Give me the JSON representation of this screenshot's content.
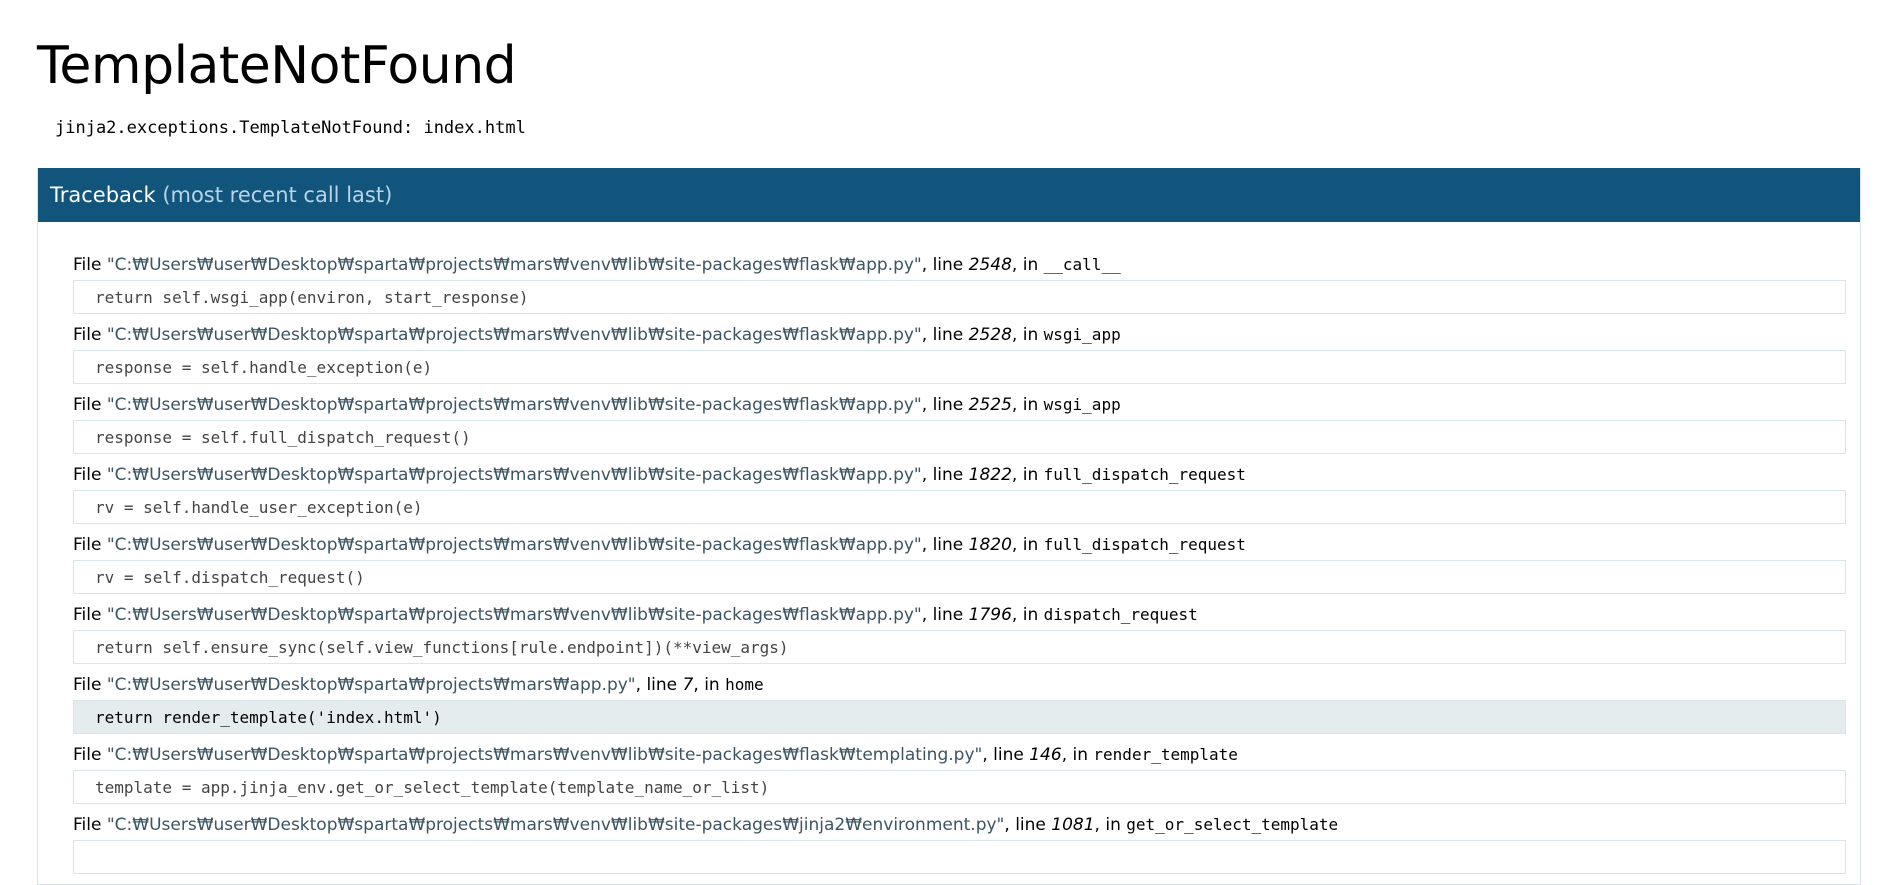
{
  "error": {
    "title": "TemplateNotFound",
    "message": "jinja2.exceptions.TemplateNotFound: index.html"
  },
  "traceback": {
    "header": "Traceback",
    "header_note": "(most recent call last)",
    "file_word": "File",
    "line_word": "line",
    "in_word": "in",
    "frames": [
      {
        "filename": "\"C:₩Users₩user₩Desktop₩sparta₩projects₩mars₩venv₩lib₩site-packages₩flask₩app.py\"",
        "lineno": "2548",
        "function": "__call__",
        "code": "return self.wsgi_app(environ, start_response)"
      },
      {
        "filename": "\"C:₩Users₩user₩Desktop₩sparta₩projects₩mars₩venv₩lib₩site-packages₩flask₩app.py\"",
        "lineno": "2528",
        "function": "wsgi_app",
        "code": "response = self.handle_exception(e)"
      },
      {
        "filename": "\"C:₩Users₩user₩Desktop₩sparta₩projects₩mars₩venv₩lib₩site-packages₩flask₩app.py\"",
        "lineno": "2525",
        "function": "wsgi_app",
        "code": "response = self.full_dispatch_request()"
      },
      {
        "filename": "\"C:₩Users₩user₩Desktop₩sparta₩projects₩mars₩venv₩lib₩site-packages₩flask₩app.py\"",
        "lineno": "1822",
        "function": "full_dispatch_request",
        "code": "rv = self.handle_user_exception(e)"
      },
      {
        "filename": "\"C:₩Users₩user₩Desktop₩sparta₩projects₩mars₩venv₩lib₩site-packages₩flask₩app.py\"",
        "lineno": "1820",
        "function": "full_dispatch_request",
        "code": "rv = self.dispatch_request()"
      },
      {
        "filename": "\"C:₩Users₩user₩Desktop₩sparta₩projects₩mars₩venv₩lib₩site-packages₩flask₩app.py\"",
        "lineno": "1796",
        "function": "dispatch_request",
        "code": "return self.ensure_sync(self.view_functions[rule.endpoint])(**view_args)"
      },
      {
        "filename": "\"C:₩Users₩user₩Desktop₩sparta₩projects₩mars₩app.py\"",
        "lineno": "7",
        "function": "home",
        "code": "return render_template('index.html')"
      },
      {
        "filename": "\"C:₩Users₩user₩Desktop₩sparta₩projects₩mars₩venv₩lib₩site-packages₩flask₩templating.py\"",
        "lineno": "146",
        "function": "render_template",
        "code": "template = app.jinja_env.get_or_select_template(template_name_or_list)"
      },
      {
        "filename": "\"C:₩Users₩user₩Desktop₩sparta₩projects₩mars₩venv₩lib₩site-packages₩jinja2₩environment.py\"",
        "lineno": "1081",
        "function": "get_or_select_template",
        "code": ""
      }
    ]
  }
}
